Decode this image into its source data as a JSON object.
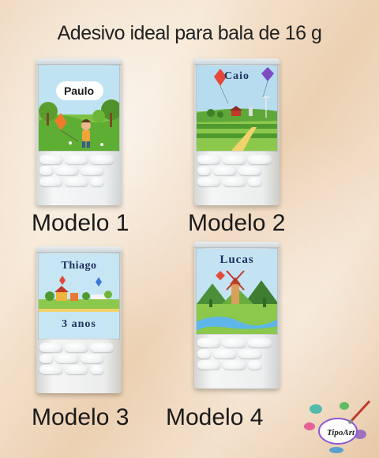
{
  "title": "Adesivo ideal para bala de 16 g",
  "models": [
    {
      "label": "Modelo 1",
      "sticker_name": "Paulo"
    },
    {
      "label": "Modelo 2",
      "sticker_name": "Caio"
    },
    {
      "label": "Modelo 3",
      "sticker_name": "Thiago",
      "sticker_extra": "3 anos"
    },
    {
      "label": "Modelo 4",
      "sticker_name": "Lucas"
    }
  ],
  "logo": {
    "text": "TipoArt"
  },
  "colors": {
    "sky": "#bfe3f2",
    "grass": "#7cc143",
    "field_dark": "#4f9a2f",
    "name_dark": "#1d2f5c"
  }
}
